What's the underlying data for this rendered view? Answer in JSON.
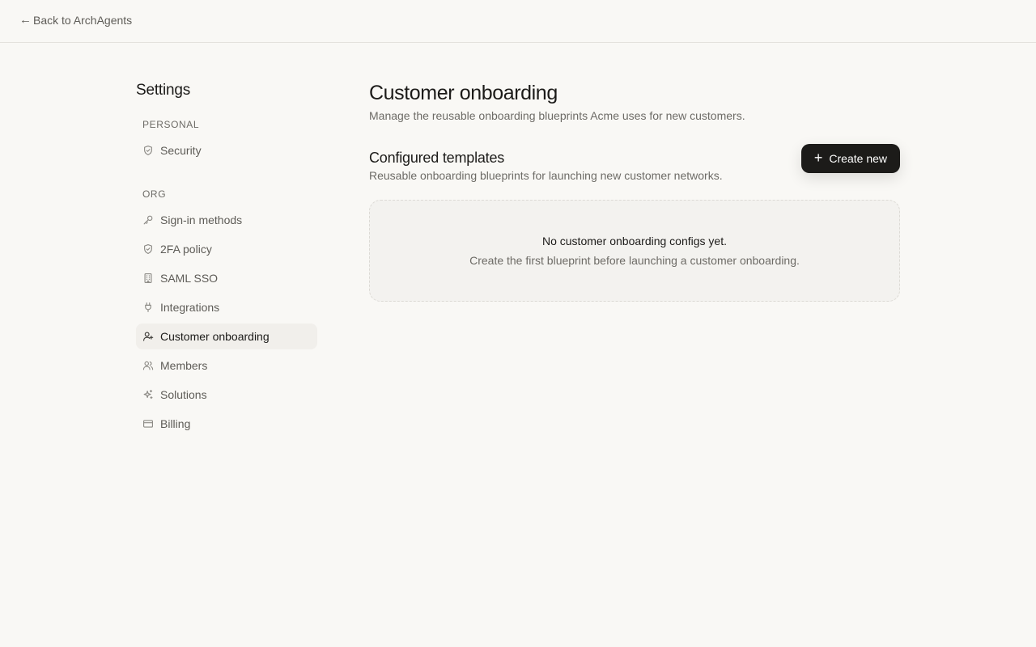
{
  "topbar": {
    "back_arrow": "←",
    "back_label": "Back to ArchAgents"
  },
  "sidebar": {
    "title": "Settings",
    "personal_label": "PERSONAL",
    "org_label": "ORG",
    "personal_items": [
      {
        "label": "Security",
        "icon": "shield-icon"
      }
    ],
    "org_items": [
      {
        "label": "Sign-in methods",
        "icon": "key-icon"
      },
      {
        "label": "2FA policy",
        "icon": "shield-icon"
      },
      {
        "label": "SAML SSO",
        "icon": "building-icon"
      },
      {
        "label": "Integrations",
        "icon": "plug-icon"
      },
      {
        "label": "Customer onboarding",
        "icon": "user-plus-icon",
        "active": true
      },
      {
        "label": "Members",
        "icon": "users-icon"
      },
      {
        "label": "Solutions",
        "icon": "sparkles-icon"
      },
      {
        "label": "Billing",
        "icon": "credit-card-icon"
      }
    ]
  },
  "main": {
    "title": "Customer onboarding",
    "subtitle": "Manage the reusable onboarding blueprints Acme uses for new customers.",
    "section": {
      "title": "Configured templates",
      "description": "Reusable onboarding blueprints for launching new customer networks.",
      "create_icon": "+",
      "create_label": "Create new"
    },
    "empty_state": {
      "title": "No customer onboarding configs yet.",
      "description": "Create the first blueprint before launching a customer onboarding."
    }
  },
  "colors": {
    "background": "#f9f8f5",
    "primary_button": "#1c1b19",
    "active_nav": "#f1efeb",
    "muted_text": "#6d6b66"
  }
}
